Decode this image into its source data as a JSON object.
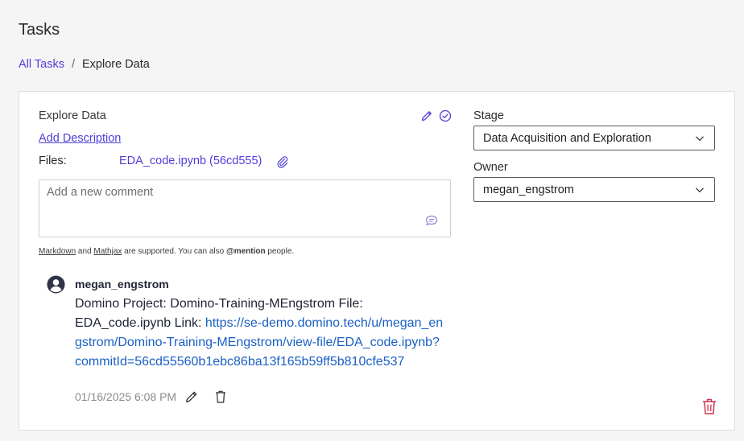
{
  "header": {
    "title": "Tasks"
  },
  "breadcrumb": {
    "root": "All Tasks",
    "separator": "/",
    "current": "Explore Data"
  },
  "task": {
    "title": "Explore Data",
    "add_description": "Add Description",
    "files_label": "Files:",
    "file_link": "EDA_code.ipynb (56cd555)"
  },
  "comment_input": {
    "placeholder": "Add a new comment"
  },
  "help": {
    "markdown": "Markdown",
    "and": " and ",
    "mathjax": "Mathjax",
    "middle": " are supported. You can also ",
    "mention": "@mention",
    "end": " people."
  },
  "comments": [
    {
      "author": "megan_engstrom",
      "text": "Domino Project: Domino-Training-MEngstrom File: EDA_code.ipynb Link: ",
      "link": "https://se-demo.domino.tech/u/megan_engstrom/Domino-Training-MEngstrom/view-file/EDA_code.ipynb?commitId=56cd55560b1ebc86ba13f165b59ff5b810cfe537",
      "timestamp": "01/16/2025 6:08 PM"
    }
  ],
  "stage": {
    "label": "Stage",
    "value": "Data Acquisition and Exploration"
  },
  "owner": {
    "label": "Owner",
    "value": "megan_engstrom"
  },
  "colors": {
    "accent": "#4f3fd8",
    "link": "#1a5fc4",
    "danger": "#d0334a"
  },
  "icons": [
    "pencil-icon",
    "check-circle-icon",
    "paperclip-icon",
    "comment-icon",
    "user-avatar-icon",
    "trash-icon",
    "chevron-down-icon"
  ]
}
